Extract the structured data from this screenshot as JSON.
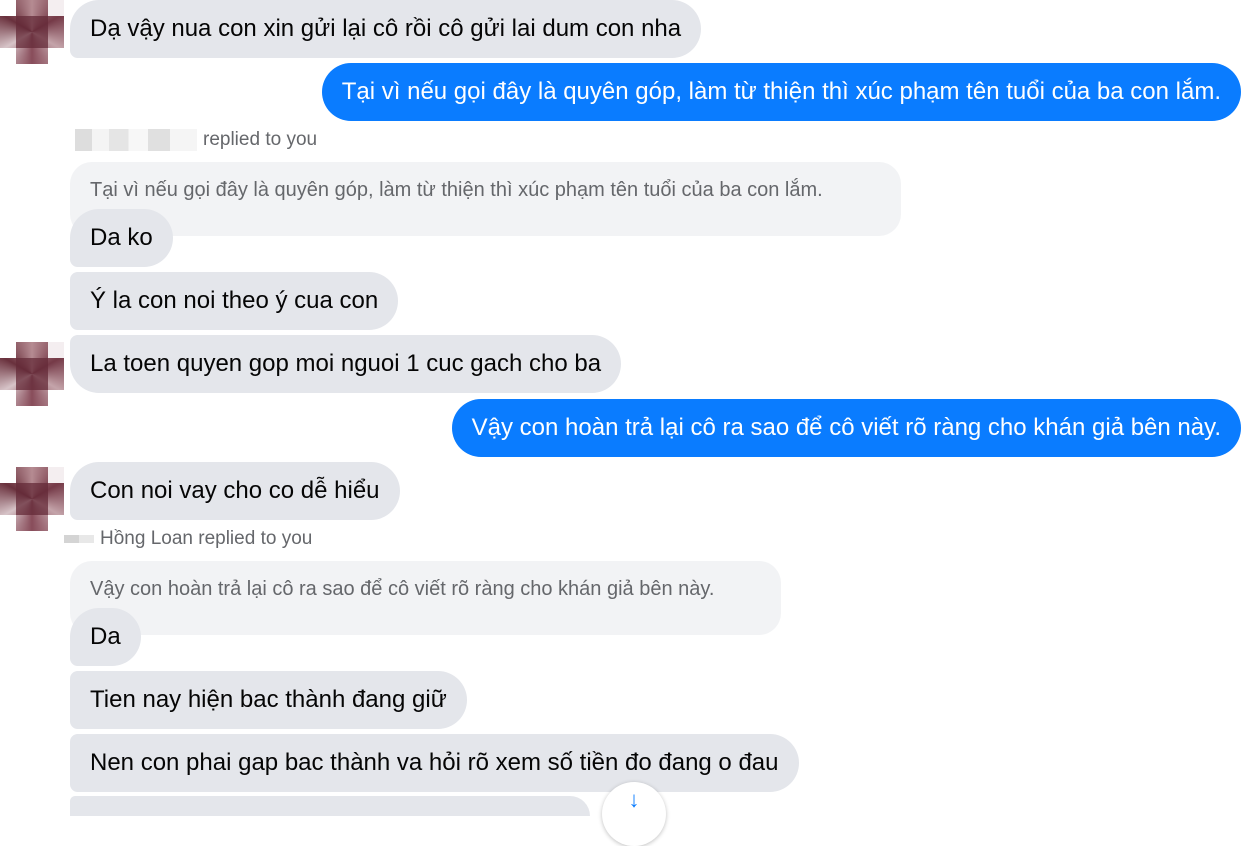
{
  "chat": {
    "messages": [
      {
        "id": "m1",
        "sender": "contact",
        "text": "Dạ vậy nua con xin gửi lại cô rồi cô gửi lai dum con nha"
      },
      {
        "id": "m2",
        "sender": "me",
        "text": "Tại vì nếu gọi đây là quyên góp, làm từ thiện thì xúc phạm tên tuổi của ba con lắm."
      },
      {
        "id": "m3",
        "sender": "contact",
        "reply_label": "replied to you",
        "quoted_text": "Tại vì nếu gọi đây là quyên góp, làm từ thiện thì xúc phạm tên tuổi của ba con lắm.",
        "text": "Da ko"
      },
      {
        "id": "m4",
        "sender": "contact",
        "text": "Ý la con noi theo ý cua con"
      },
      {
        "id": "m5",
        "sender": "contact",
        "text": "La toen quyen gop moi nguoi 1 cuc gach cho ba"
      },
      {
        "id": "m6",
        "sender": "me",
        "text": "Vậy con hoàn trả lại cô ra sao để cô viết rõ ràng cho khán giả bên này."
      },
      {
        "id": "m7",
        "sender": "contact",
        "text": "Con noi vay cho co dễ hiểu"
      },
      {
        "id": "m8",
        "sender": "contact",
        "reply_label": "Hồng Loan replied to you",
        "quoted_text": "Vậy con hoàn trả lại cô ra sao để cô viết rõ ràng cho khán giả bên này.",
        "text": "Da"
      },
      {
        "id": "m9",
        "sender": "contact",
        "text": "Tien nay hiện bac thành đang giữ"
      },
      {
        "id": "m10",
        "sender": "contact",
        "text": "Nen con phai gap bac thành va hỏi rõ xem số tiền đo đang o đau"
      }
    ]
  },
  "colors": {
    "outgoing_bubble": "#0a7cff",
    "incoming_bubble": "#e4e6eb",
    "quoted_bubble": "#f2f3f5",
    "secondary_text": "#65676b"
  },
  "icons": {
    "scroll_down": "arrow-down-icon",
    "avatar": "blurred-contact-avatar"
  },
  "scroll_button": {
    "glyph": "↓"
  }
}
